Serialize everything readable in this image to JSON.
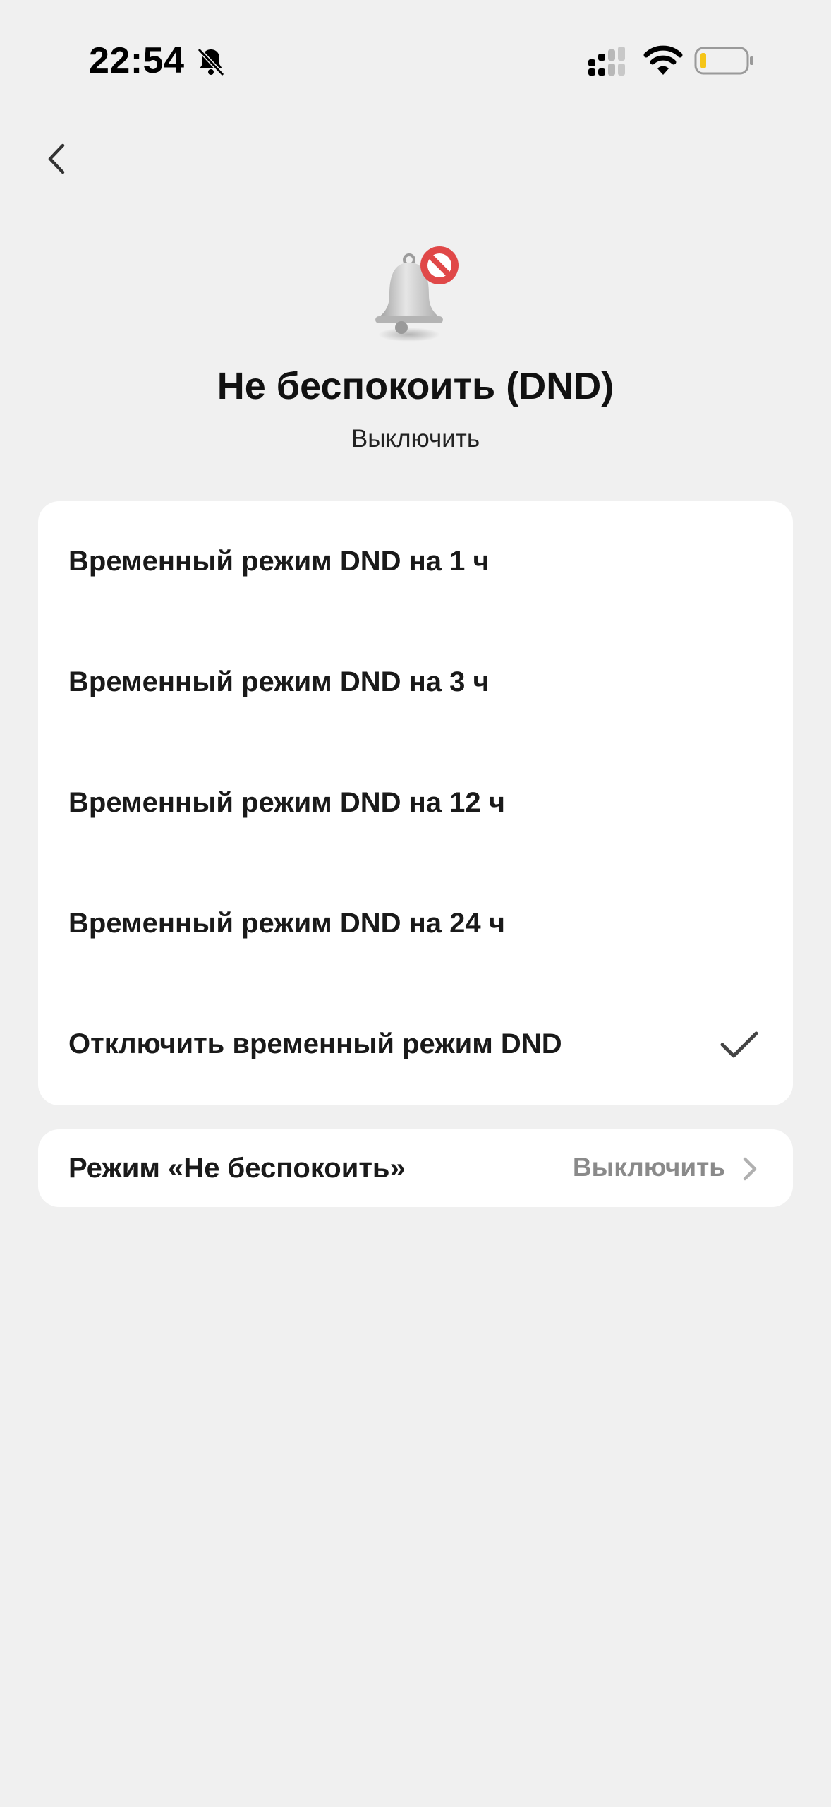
{
  "status_bar": {
    "time": "22:54",
    "icons": [
      "bell-slash-icon",
      "cellular-signal-icon",
      "wifi-icon",
      "battery-low-icon"
    ],
    "battery_color": "#f5c518"
  },
  "nav": {
    "back_icon": "chevron-left-icon"
  },
  "header": {
    "icon": "bell-no-entry-icon",
    "title": "Не беспокоить (DND)",
    "subtitle": "Выключить"
  },
  "options": {
    "items": [
      {
        "label": "Временный режим DND на 1 ч",
        "selected": false
      },
      {
        "label": "Временный режим DND на 3 ч",
        "selected": false
      },
      {
        "label": "Временный режим DND на 12 ч",
        "selected": false
      },
      {
        "label": "Временный режим DND на 24 ч",
        "selected": false
      },
      {
        "label": "Отключить временный режим DND",
        "selected": true
      }
    ]
  },
  "dnd_mode": {
    "label": "Режим «Не беспокоить»",
    "value": "Выключить"
  },
  "colors": {
    "background": "#f0f0f0",
    "card": "#ffffff",
    "accent_red": "#e04848",
    "muted_text": "#8a8a8a"
  }
}
